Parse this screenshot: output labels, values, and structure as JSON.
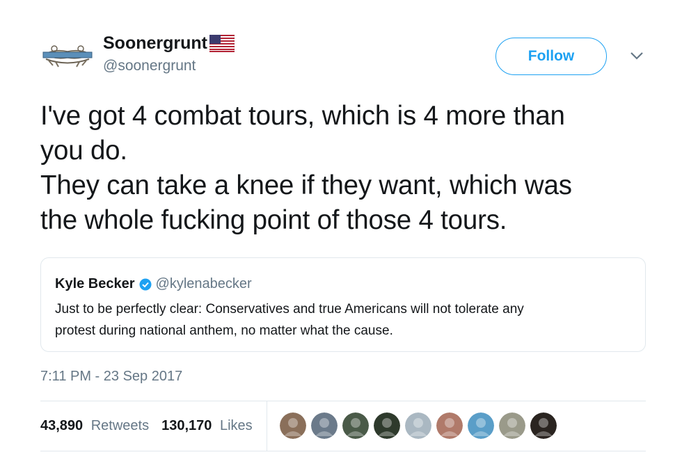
{
  "user": {
    "display_name": "Soonergrunt",
    "handle": "@soonergrunt",
    "avatar_icon": "combat-infantry-badge-icon",
    "flag_icon": "us-flag-icon"
  },
  "follow_label": "Follow",
  "tweet": {
    "lines": [
      "I've got 4 combat tours, which is 4 more than",
      "you do.",
      "They can take a knee if they want, which was",
      "the whole fucking point of those 4 tours."
    ]
  },
  "quote": {
    "name": "Kyle Becker",
    "handle": "@kylenabecker",
    "text_lines": [
      "Just to be perfectly clear: Conservatives and true Americans will not tolerate any",
      "protest during national anthem, no matter what the cause."
    ]
  },
  "timestamp": "7:11 PM - 23 Sep 2017",
  "stats": {
    "retweets_count": "43,890",
    "retweets_label": "Retweets",
    "likes_count": "130,170",
    "likes_label": "Likes"
  },
  "likers": [
    {
      "color": "#8a6f5a"
    },
    {
      "color": "#6b7a8a"
    },
    {
      "color": "#4a5a48"
    },
    {
      "color": "#2e3a2c"
    },
    {
      "color": "#aab8c2"
    },
    {
      "color": "#b07a6a"
    },
    {
      "color": "#5a9ec8"
    },
    {
      "color": "#9a9a8a"
    },
    {
      "color": "#2a2420"
    }
  ],
  "colors": {
    "accent": "#1da1f2",
    "secondary_text": "#657786",
    "border": "#e1e8ed"
  }
}
